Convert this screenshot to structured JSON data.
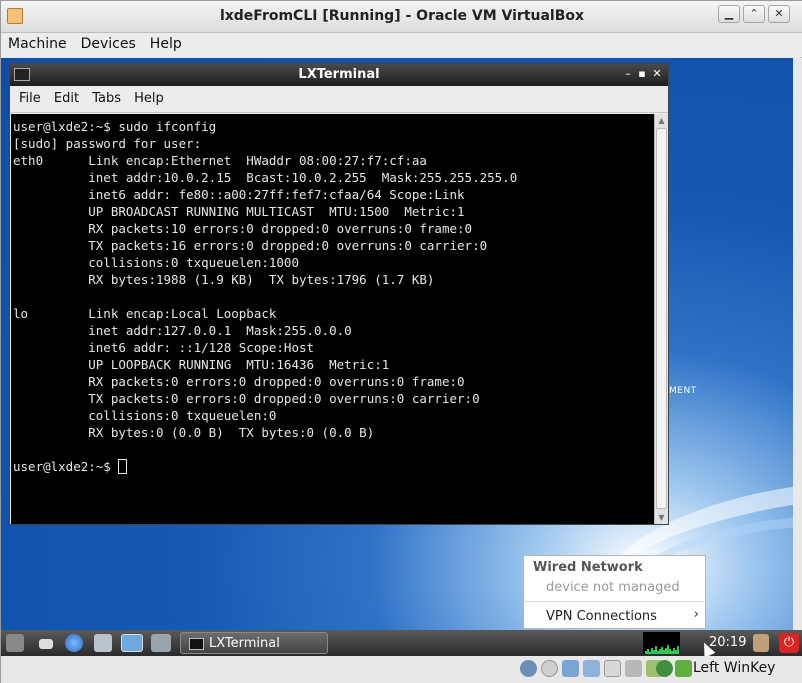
{
  "host": {
    "title": "lxdeFromCLI [Running] - Oracle VM VirtualBox",
    "menu": [
      "Machine",
      "Devices",
      "Help"
    ],
    "status_key": "Left WinKey"
  },
  "terminal": {
    "title": "LXTerminal",
    "menu": [
      "File",
      "Edit",
      "Tabs",
      "Help"
    ],
    "lines": [
      "user@lxde2:~$ sudo ifconfig",
      "[sudo] password for user:",
      "eth0      Link encap:Ethernet  HWaddr 08:00:27:f7:cf:aa",
      "          inet addr:10.0.2.15  Bcast:10.0.2.255  Mask:255.255.255.0",
      "          inet6 addr: fe80::a00:27ff:fef7:cfaa/64 Scope:Link",
      "          UP BROADCAST RUNNING MULTICAST  MTU:1500  Metric:1",
      "          RX packets:10 errors:0 dropped:0 overruns:0 frame:0",
      "          TX packets:16 errors:0 dropped:0 overruns:0 carrier:0",
      "          collisions:0 txqueuelen:1000",
      "          RX bytes:1988 (1.9 KB)  TX bytes:1796 (1.7 KB)",
      "",
      "lo        Link encap:Local Loopback",
      "          inet addr:127.0.0.1  Mask:255.0.0.0",
      "          inet6 addr: ::1/128 Scope:Host",
      "          UP LOOPBACK RUNNING  MTU:16436  Metric:1",
      "          RX packets:0 errors:0 dropped:0 overruns:0 frame:0",
      "          TX packets:0 errors:0 dropped:0 overruns:0 carrier:0",
      "          collisions:0 txqueuelen:0",
      "          RX bytes:0 (0.0 B)  TX bytes:0 (0.0 B)",
      ""
    ],
    "prompt": "user@lxde2:~$ "
  },
  "network_popup": {
    "header": "Wired Network",
    "status": "device not managed",
    "vpn_label": "VPN Connections"
  },
  "wallpaper_text": "MENT",
  "taskbar": {
    "task_label": "LXTerminal",
    "clock": "20:19"
  }
}
